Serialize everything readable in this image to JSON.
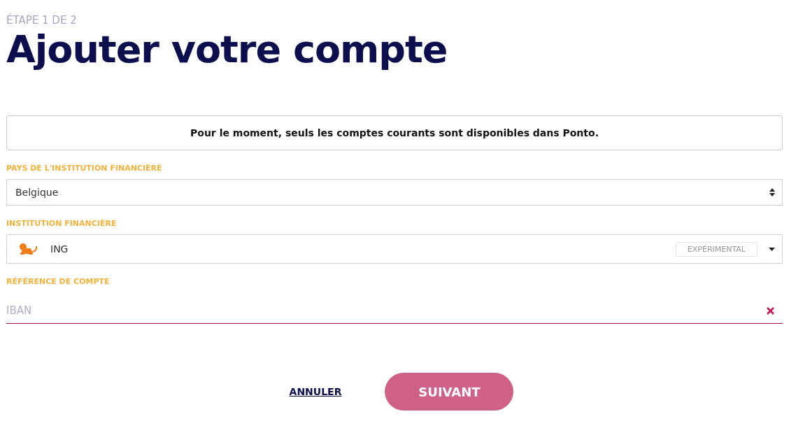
{
  "step": "ÉTAPE 1 DE 2",
  "title": "Ajouter votre compte",
  "notice": "Pour le moment, seuls les comptes courants sont disponibles dans Ponto.",
  "country": {
    "label": "PAYS DE L'INSTITUTION FINANCIÈRE",
    "value": "Belgique"
  },
  "institution": {
    "label": "INSTITUTION FINANCIÈRE",
    "value": "ING",
    "badge": "EXPÉRIMENTAL"
  },
  "account": {
    "label": "RÉFÉRENCE DE COMPTE",
    "placeholder": "IBAN"
  },
  "buttons": [
    {
      "kind": "link",
      "label": "ANNULER"
    },
    {
      "kind": "primary",
      "label": "SUIVANT"
    }
  ]
}
